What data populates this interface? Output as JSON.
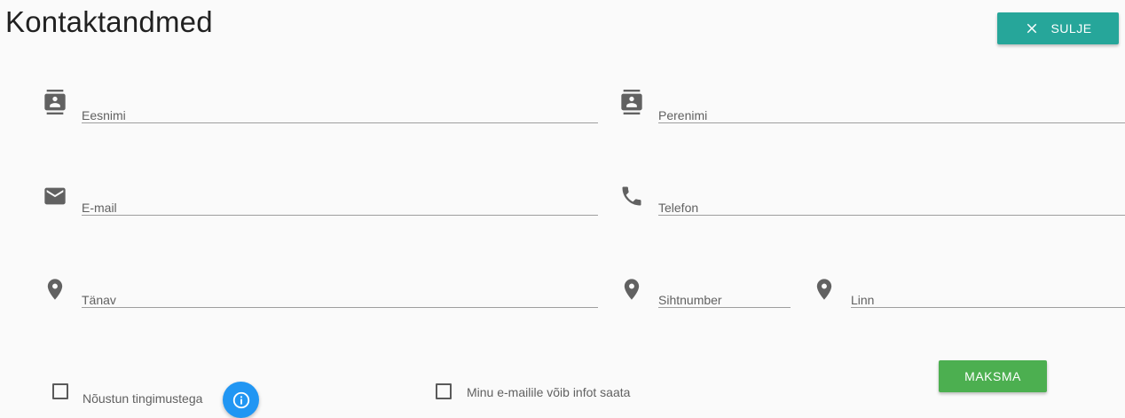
{
  "header": {
    "title": "Kontaktandmed",
    "close_label": "SULJE"
  },
  "form": {
    "first_name": {
      "placeholder": "Eesnimi",
      "icon": "contact-icon"
    },
    "last_name": {
      "placeholder": "Perenimi",
      "icon": "contact-icon"
    },
    "email": {
      "placeholder": "E-mail",
      "icon": "mail-icon"
    },
    "phone": {
      "placeholder": "Telefon",
      "icon": "phone-icon"
    },
    "street": {
      "placeholder": "Tänav",
      "icon": "location-pin-icon"
    },
    "postal_code": {
      "placeholder": "Sihtnumber",
      "icon": "location-pin-icon"
    },
    "city": {
      "placeholder": "Linn",
      "icon": "location-pin-icon"
    }
  },
  "consent": {
    "terms_label": "Nõustun tingimustega",
    "newsletter_label": "Minu e-mailile võib infot saata"
  },
  "actions": {
    "pay_label": "MAKSMA"
  },
  "colors": {
    "close_button": "#26a69a",
    "pay_button": "#4caf50",
    "info_button": "#2196f3",
    "icon": "#616161"
  }
}
